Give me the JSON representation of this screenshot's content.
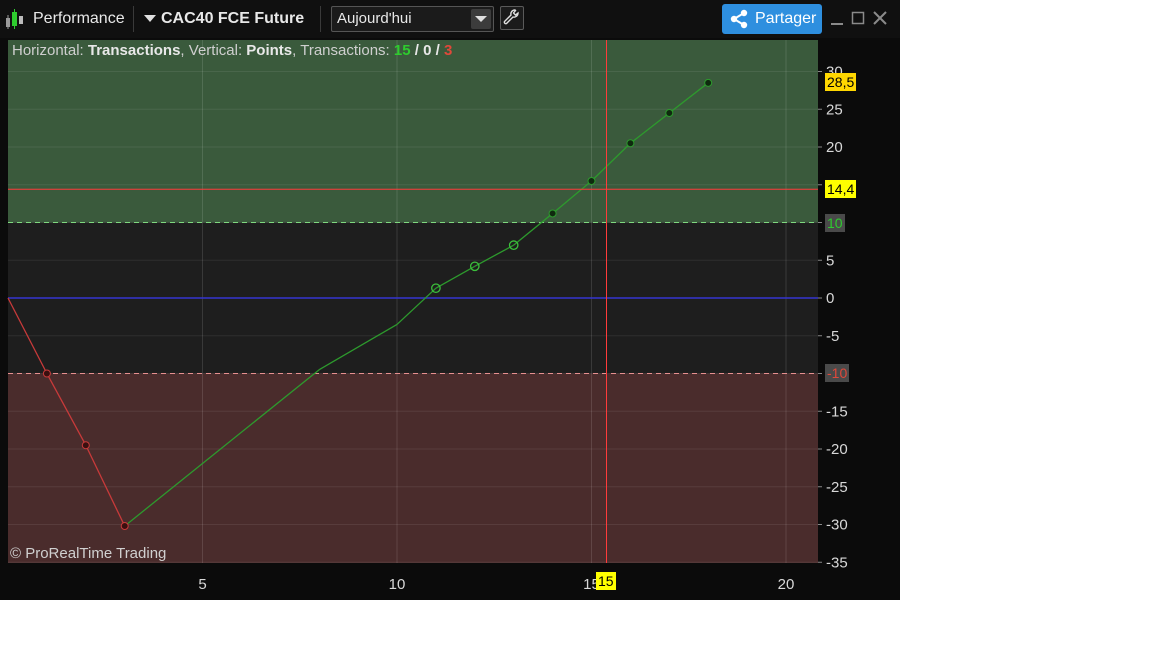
{
  "toolbar": {
    "indicator_name": "Performance",
    "instrument": "CAC40 FCE Future",
    "period": "Aujourd'hui",
    "share_label": "Partager"
  },
  "info": {
    "horizontal_label": "Horizontal:",
    "horizontal_value": "Transactions",
    "vertical_label": "Vertical:",
    "vertical_value": "Points",
    "transactions_label": "Transactions:",
    "wins": "15",
    "neutral": "0",
    "losses": "3",
    "sep1": "/",
    "sep2": "/"
  },
  "copyright": "© ProRealTime Trading",
  "tags": {
    "last_value": "28,5",
    "cursor_y": "14,4",
    "upper_level": "10",
    "lower_level": "-10",
    "cursor_x": "15"
  },
  "colors": {
    "gain_zone": "#3a5a3c",
    "loss_zone": "#4a2c2c",
    "gain_line": "#2d9a2d",
    "loss_line": "#c83a3a",
    "zero_line": "#3535d0",
    "cursor": "#ff3b3b",
    "tag_yellow": "#ffd700",
    "win_count": "#2ecc2e",
    "loss_count": "#e0483a"
  },
  "chart_data": {
    "type": "line",
    "xlabel": "",
    "ylabel": "",
    "xlim": [
      0,
      21
    ],
    "ylim": [
      -35,
      30
    ],
    "x_ticks": [
      5,
      10,
      15,
      20
    ],
    "y_ticks": [
      30,
      25,
      20,
      15,
      10,
      5,
      0,
      -5,
      -10,
      -15,
      -20,
      -25,
      -30,
      -35
    ],
    "grid": true,
    "zones": {
      "upper": 10,
      "lower": -10
    },
    "zero_line": 0,
    "cursor": {
      "x": 15,
      "y": 14.4
    },
    "points": [
      {
        "x": 0,
        "y": 0,
        "marker": "none"
      },
      {
        "x": 1,
        "y": -10,
        "marker": "dot"
      },
      {
        "x": 2,
        "y": -19.5,
        "marker": "dot"
      },
      {
        "x": 3,
        "y": -30.2,
        "marker": "dot"
      },
      {
        "x": 8,
        "y": -9.5,
        "marker": "none"
      },
      {
        "x": 10,
        "y": -3.5,
        "marker": "none"
      },
      {
        "x": 11,
        "y": 1.3,
        "marker": "circle"
      },
      {
        "x": 12,
        "y": 4.2,
        "marker": "circle"
      },
      {
        "x": 13,
        "y": 7.0,
        "marker": "circle"
      },
      {
        "x": 14,
        "y": 11.2,
        "marker": "dot"
      },
      {
        "x": 15,
        "y": 15.5,
        "marker": "dot"
      },
      {
        "x": 16,
        "y": 20.5,
        "marker": "dot"
      },
      {
        "x": 17,
        "y": 24.5,
        "marker": "dot"
      },
      {
        "x": 18,
        "y": 28.5,
        "marker": "dot"
      }
    ]
  }
}
